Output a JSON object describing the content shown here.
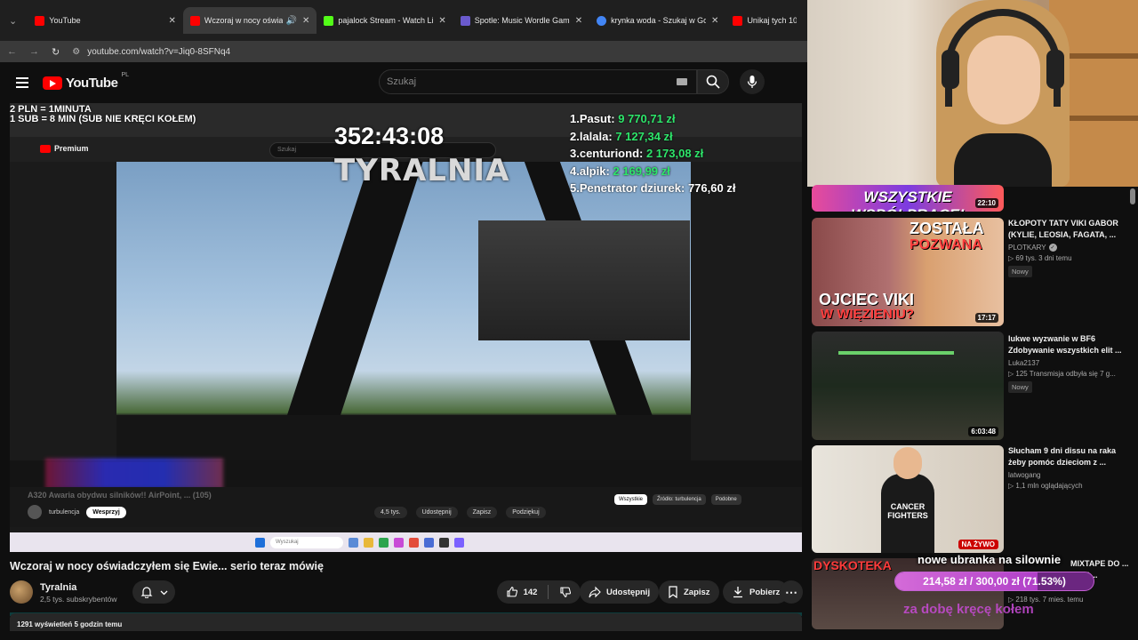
{
  "tabs": [
    {
      "title": "YouTube",
      "color": "#ff0000"
    },
    {
      "title": "Wczoraj w nocy oświadczył",
      "color": "#ff0000",
      "active": true
    },
    {
      "title": "pajalock Stream - Watch Live o",
      "color": "#53fc18"
    },
    {
      "title": "Spotle: Music Wordle Game",
      "color": "#6a5acd"
    },
    {
      "title": "krynka woda - Szukaj w Google",
      "color": "#4285f4"
    },
    {
      "title": "Unikaj tych 10 wów",
      "color": "#ff0000"
    }
  ],
  "address": {
    "url": "youtube.com/watch?v=Jiq0-8SFNq4"
  },
  "header": {
    "logo": "YouTube",
    "country": "PL",
    "search_placeholder": "Szukaj"
  },
  "stream_overlay": {
    "rules_line1": "2 PLN = 1MINUTA",
    "rules_line2": "1 SUB = 8 MIN (SUB NIE KRĘCI KOŁEM)",
    "timer": "352:43:08",
    "brand": "TYRALNIA",
    "leaderboard": [
      {
        "rank": "1.",
        "name": "Pasut:",
        "amount": "9 770,71 zł"
      },
      {
        "rank": "2.",
        "name": "lalala:",
        "amount": "7 127,34 zł"
      },
      {
        "rank": "3.",
        "name": "centuriond:",
        "amount": "2 173,08 zł"
      },
      {
        "rank": "4.",
        "name": "alpik:",
        "amount": "2 169,99 zł"
      },
      {
        "rank": "5.",
        "name": "Penetrator dziurek:",
        "amount": "776,60 zł"
      }
    ]
  },
  "inner_page": {
    "premium": "Premium",
    "search": "Szukaj",
    "video_title": "A320 Awaria obydwu silników!! AirPoint, ... (105)",
    "channel": "turbulencja",
    "subscribe": "Wesprzyj",
    "likes": "4,5 tys.",
    "share": "Udostępnij",
    "save": "Zapisz",
    "thanks": "Podziękuj",
    "chips": [
      "Wszystkie",
      "Źródło: turbulencja",
      "Podobne"
    ],
    "taskbar_search": "Wyszukaj"
  },
  "video": {
    "title": "Wczoraj w nocy oświadczyłem się Ewie... serio teraz mówię",
    "channel": "Tyralnia",
    "subscribers": "2,5 tys. subskrybentów",
    "likes": "142",
    "share": "Udostępnij",
    "save": "Zapisz",
    "download": "Pobierz",
    "views": "1291 wyświetleń  5 godzin temu"
  },
  "recommendations": [
    {
      "title": "WSZYSTKIE WSPÓŁPRACE!",
      "duration": "22:10",
      "partial": true
    },
    {
      "title": "KŁOPOTY TATY VIKI GABOR (KYLIE, LEOSIA, FAGATA, ...",
      "channel": "PLOTKARY",
      "verified": true,
      "meta": "69 tys.  3 dni temu",
      "badge": "Nowy",
      "duration": "17:17",
      "thumb_text1": "ZOSTAŁA",
      "thumb_text2": "POZWANA",
      "thumb_text3": "OJCIEC VIKI",
      "thumb_text4": "W WIĘZIENIU?"
    },
    {
      "title": "lukwe wyzwanie w BF6 Zdobywanie wszystkich elit ...",
      "channel": "Luka2137",
      "meta": "125  Transmisja odbyła się 7 g...",
      "badge": "Nowy",
      "duration": "6:03:48"
    },
    {
      "title": "Słucham 9 dni dissu na raka żeby pomóc dzieciom z ...",
      "channel": "latwogang",
      "meta": "1,1 mln oglądających",
      "live": "NA ŻYWO",
      "thumb_text": "CANCER FIGHTERS"
    },
    {
      "title": "MIXTAPE DO ... KI JA...",
      "channel": "...eat",
      "meta": "218 tys.  7 mies. temu",
      "thumb_text": "DYSKOTEKA"
    }
  ],
  "donation": {
    "title": "nowe ubranka na silownie",
    "progress_text": "214,58 zł / 300,00 zł (71.53%)",
    "progress": 0.7153,
    "subtitle": "za dobę kręcę kołem"
  }
}
